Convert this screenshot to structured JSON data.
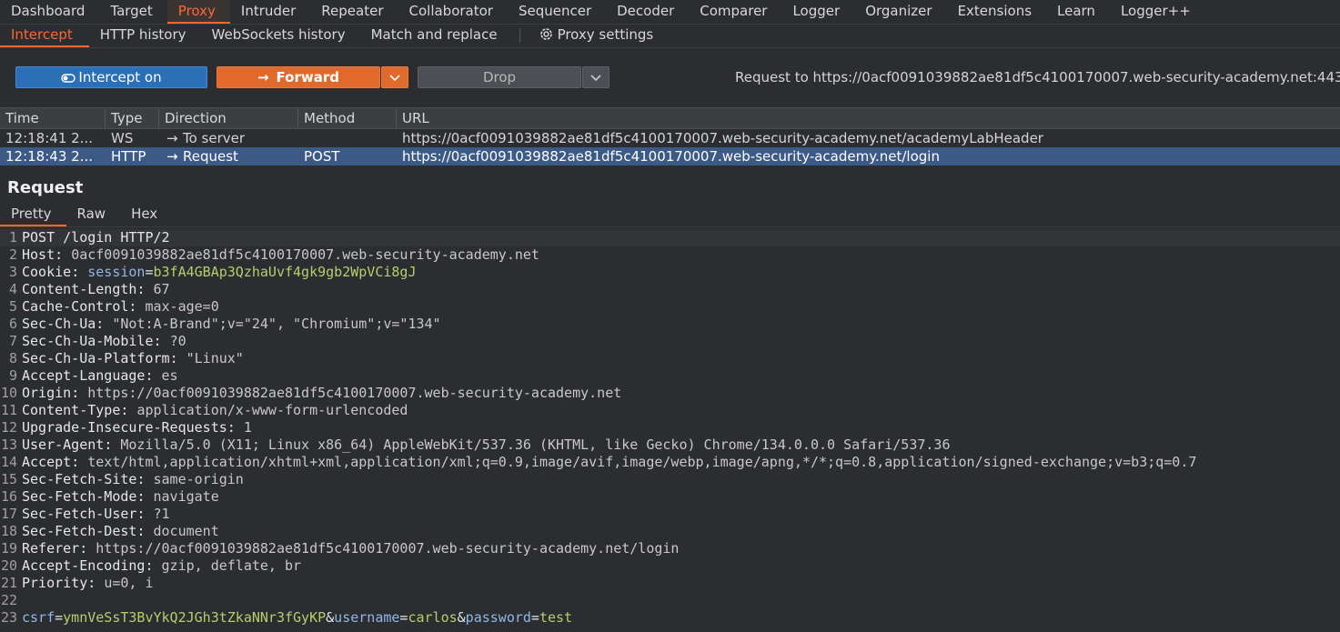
{
  "main_tabs": [
    "Dashboard",
    "Target",
    "Proxy",
    "Intruder",
    "Repeater",
    "Collaborator",
    "Sequencer",
    "Decoder",
    "Comparer",
    "Logger",
    "Organizer",
    "Extensions",
    "Learn",
    "Logger++"
  ],
  "main_active": "Proxy",
  "sub_tabs": [
    "Intercept",
    "HTTP history",
    "WebSockets history",
    "Match and replace"
  ],
  "sub_active": "Intercept",
  "proxy_settings": "Proxy settings",
  "toolbar": {
    "intercept_label": "Intercept on",
    "forward_label": "Forward",
    "drop_label": "Drop",
    "request_to": "Request to https://0acf0091039882ae81df5c4100170007.web-security-academy.net:443"
  },
  "table": {
    "columns": [
      "Time",
      "Type",
      "Direction",
      "Method",
      "URL"
    ],
    "rows": [
      {
        "time": "12:18:41 2...",
        "type": "WS",
        "direction": "To server",
        "method": "",
        "url": "https://0acf0091039882ae81df5c4100170007.web-security-academy.net/academyLabHeader"
      },
      {
        "time": "12:18:43 2...",
        "type": "HTTP",
        "direction": "Request",
        "method": "POST",
        "url": "https://0acf0091039882ae81df5c4100170007.web-security-academy.net/login"
      }
    ]
  },
  "request": {
    "title": "Request",
    "tabs": [
      "Pretty",
      "Raw",
      "Hex"
    ],
    "request_line": "POST /login HTTP/2",
    "headers": [
      {
        "k": "Host",
        "v": "0acf0091039882ae81df5c4100170007.web-security-academy.net"
      },
      {
        "k": "Cookie",
        "v": "",
        "cookie_name": "session",
        "cookie_value": "b3fA4GBAp3QzhaUvf4gk9gb2WpVCi8gJ"
      },
      {
        "k": "Content-Length",
        "v": "67"
      },
      {
        "k": "Cache-Control",
        "v": "max-age=0"
      },
      {
        "k": "Sec-Ch-Ua",
        "v": "\"Not:A-Brand\";v=\"24\", \"Chromium\";v=\"134\""
      },
      {
        "k": "Sec-Ch-Ua-Mobile",
        "v": "?0"
      },
      {
        "k": "Sec-Ch-Ua-Platform",
        "v": "\"Linux\""
      },
      {
        "k": "Accept-Language",
        "v": "es"
      },
      {
        "k": "Origin",
        "v": "https://0acf0091039882ae81df5c4100170007.web-security-academy.net"
      },
      {
        "k": "Content-Type",
        "v": "application/x-www-form-urlencoded"
      },
      {
        "k": "Upgrade-Insecure-Requests",
        "v": "1"
      },
      {
        "k": "User-Agent",
        "v": "Mozilla/5.0 (X11; Linux x86_64) AppleWebKit/537.36 (KHTML, like Gecko) Chrome/134.0.0.0 Safari/537.36"
      },
      {
        "k": "Accept",
        "v": "text/html,application/xhtml+xml,application/xml;q=0.9,image/avif,image/webp,image/apng,*/*;q=0.8,application/signed-exchange;v=b3;q=0.7"
      },
      {
        "k": "Sec-Fetch-Site",
        "v": "same-origin"
      },
      {
        "k": "Sec-Fetch-Mode",
        "v": "navigate"
      },
      {
        "k": "Sec-Fetch-User",
        "v": "?1"
      },
      {
        "k": "Sec-Fetch-Dest",
        "v": "document"
      },
      {
        "k": "Referer",
        "v": "https://0acf0091039882ae81df5c4100170007.web-security-academy.net/login"
      },
      {
        "k": "Accept-Encoding",
        "v": "gzip, deflate, br"
      },
      {
        "k": "Priority",
        "v": "u=0, i"
      }
    ],
    "body_params": [
      {
        "k": "csrf",
        "v": "ymnVeSsT3BvYkQ2JGh3tZkaNNr3fGyKP"
      },
      {
        "k": "username",
        "v": "carlos"
      },
      {
        "k": "password",
        "v": "test"
      }
    ]
  },
  "colors": {
    "accent": "#ff6633",
    "intercept": "#2a6fb8",
    "forward": "#e06a2c",
    "selected_row": "#3c5a86"
  }
}
